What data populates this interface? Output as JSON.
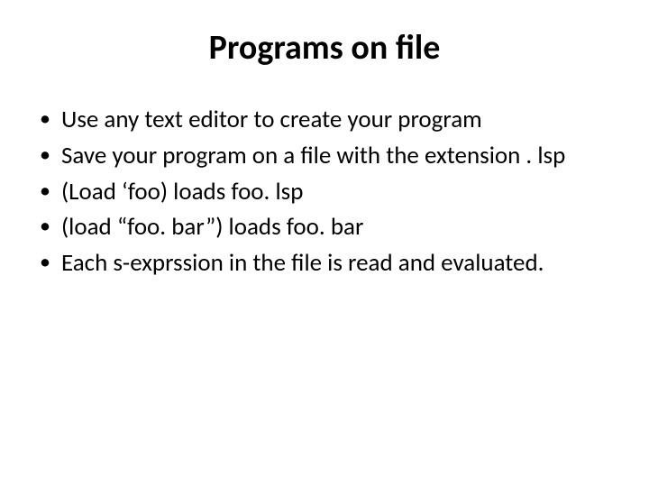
{
  "title": "Programs on file",
  "bullets": [
    "Use any text editor to create your program",
    "Save your program on a file with the extension . lsp",
    "(Load ‘foo) loads foo. lsp",
    "(load “foo. bar”) loads foo. bar",
    "Each s-exprssion in the file is read and evaluated."
  ]
}
